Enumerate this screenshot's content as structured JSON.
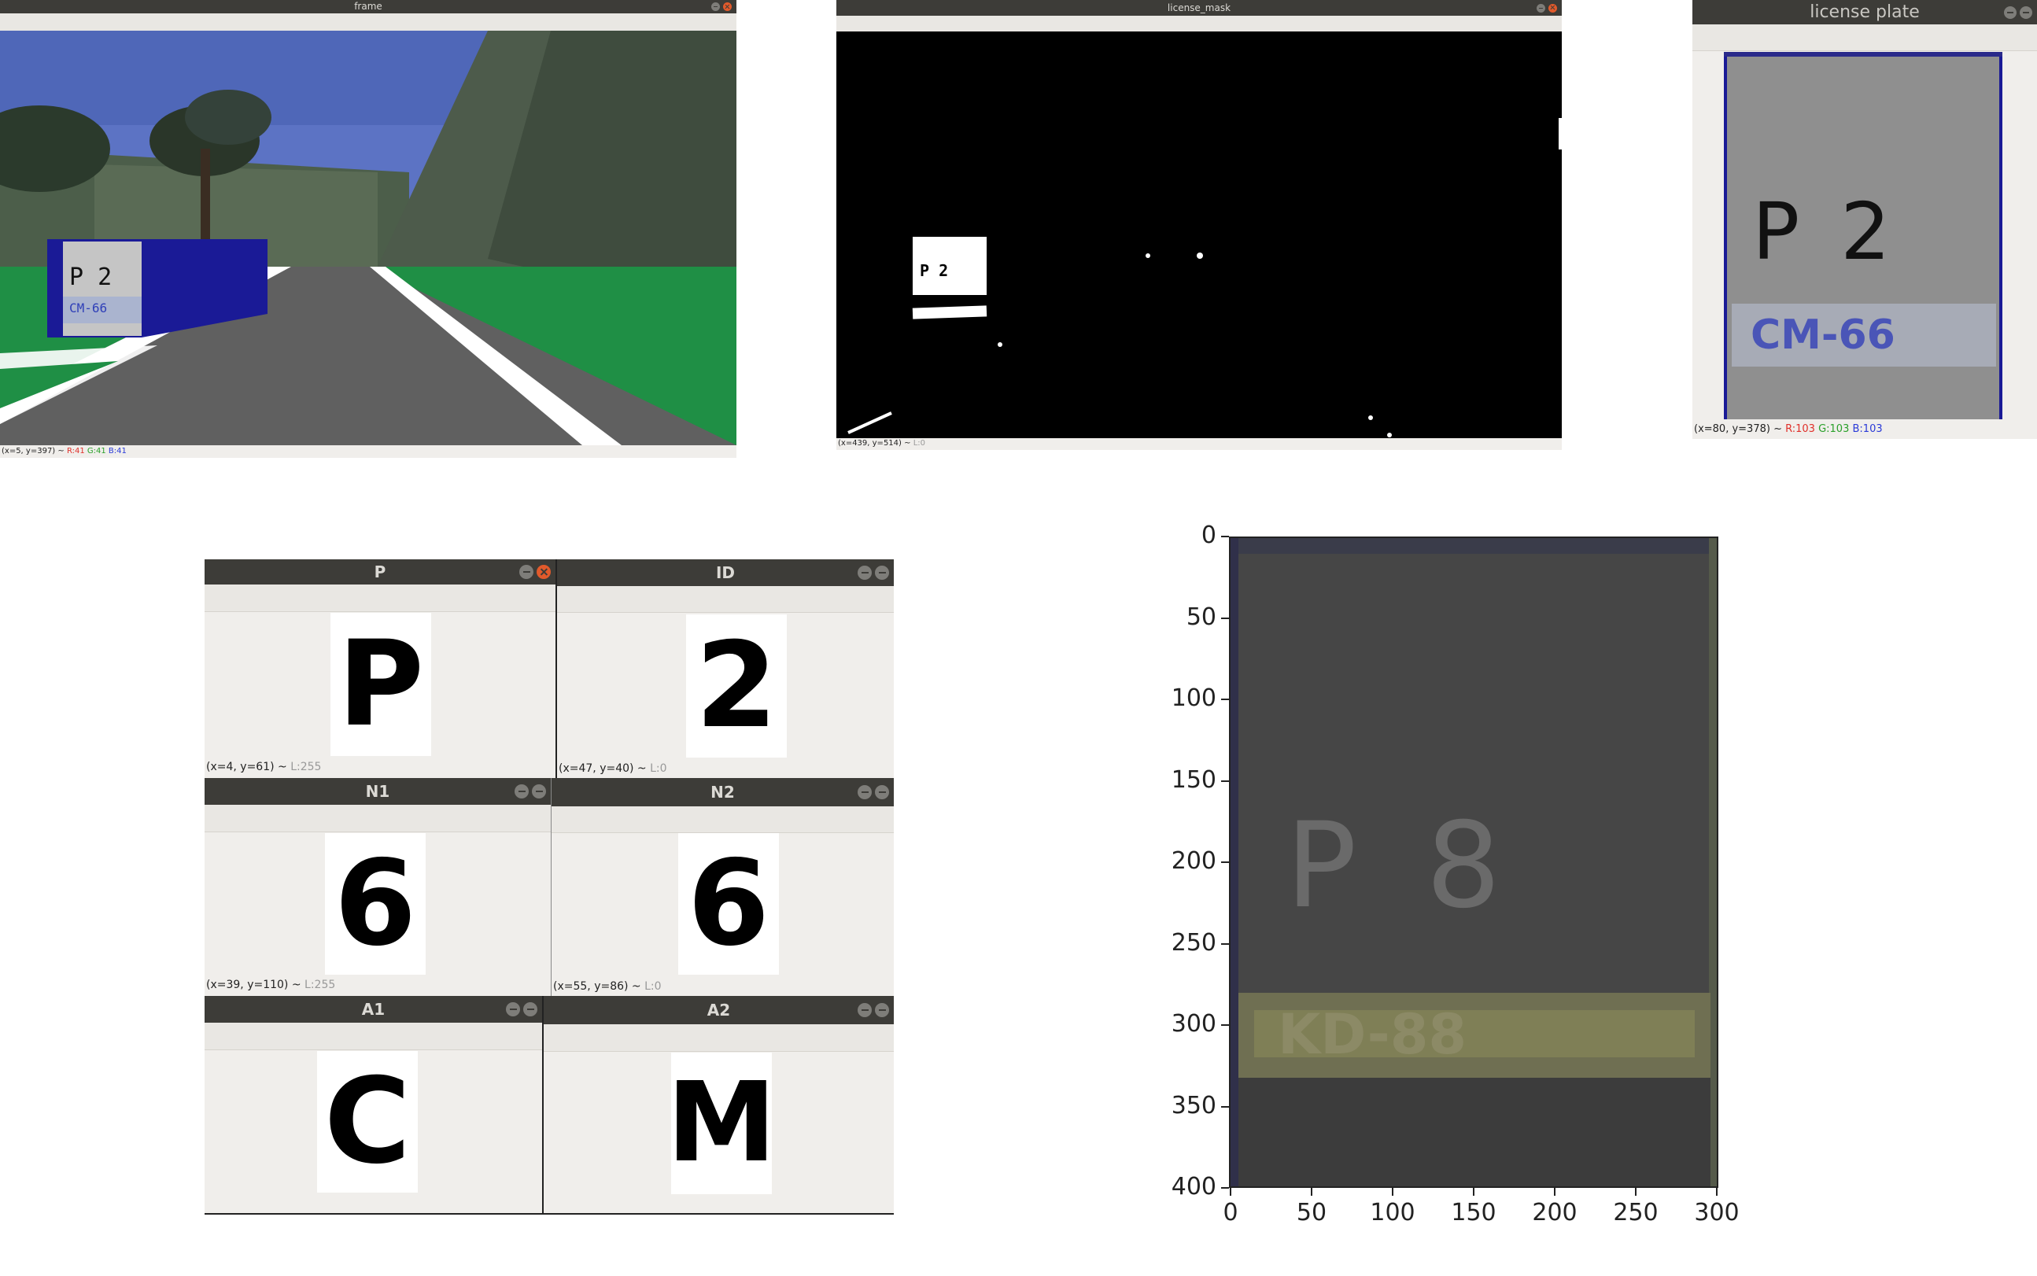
{
  "windows": {
    "frame": {
      "title": "frame",
      "status": {
        "coords": "(x=5, y=397) ~",
        "r": "R:41",
        "g": "G:41",
        "b": "B:41"
      },
      "plate_top": "P 2",
      "plate_bottom": "CM-66"
    },
    "mask": {
      "title": "license_mask",
      "status": {
        "coords": "(x=439, y=514) ~",
        "l": "L:0"
      },
      "plate_text": "P 2"
    },
    "plate": {
      "title": "license plate",
      "status": {
        "coords": "(x=80, y=378) ~",
        "r": "R:103",
        "g": "G:103",
        "b": "B:103"
      },
      "top_text": "P 2",
      "bottom_text": "CM-66"
    },
    "chars": [
      {
        "title": "P",
        "char": "P",
        "status": "(x=4, y=61) ~",
        "level": "L:255"
      },
      {
        "title": "ID",
        "char": "2",
        "status": "(x=47, y=40) ~",
        "level": "L:0"
      },
      {
        "title": "N1",
        "char": "6",
        "status": "(x=39, y=110) ~",
        "level": "L:255"
      },
      {
        "title": "N2",
        "char": "6",
        "status": "(x=55, y=86) ~",
        "level": "L:0"
      },
      {
        "title": "A1",
        "char": "C",
        "status": "",
        "level": ""
      },
      {
        "title": "A2",
        "char": "M",
        "status": "",
        "level": ""
      }
    ]
  },
  "plot": {
    "y_ticks": [
      "0",
      "50",
      "100",
      "150",
      "200",
      "250",
      "300",
      "350",
      "400"
    ],
    "x_ticks": [
      "0",
      "50",
      "100",
      "150",
      "200",
      "250",
      "300"
    ],
    "top_text": "P 8",
    "bottom_text": "KD-88",
    "x_range": [
      0,
      300
    ],
    "y_range": [
      0,
      400
    ]
  },
  "colors": {
    "titlebar": "#3d3c38",
    "close": "#e25a2b",
    "window_bg": "#f0eeeb",
    "plate_blue": "#1a1a96",
    "grass": "#1f8f45",
    "sky": "#4f67b8"
  }
}
